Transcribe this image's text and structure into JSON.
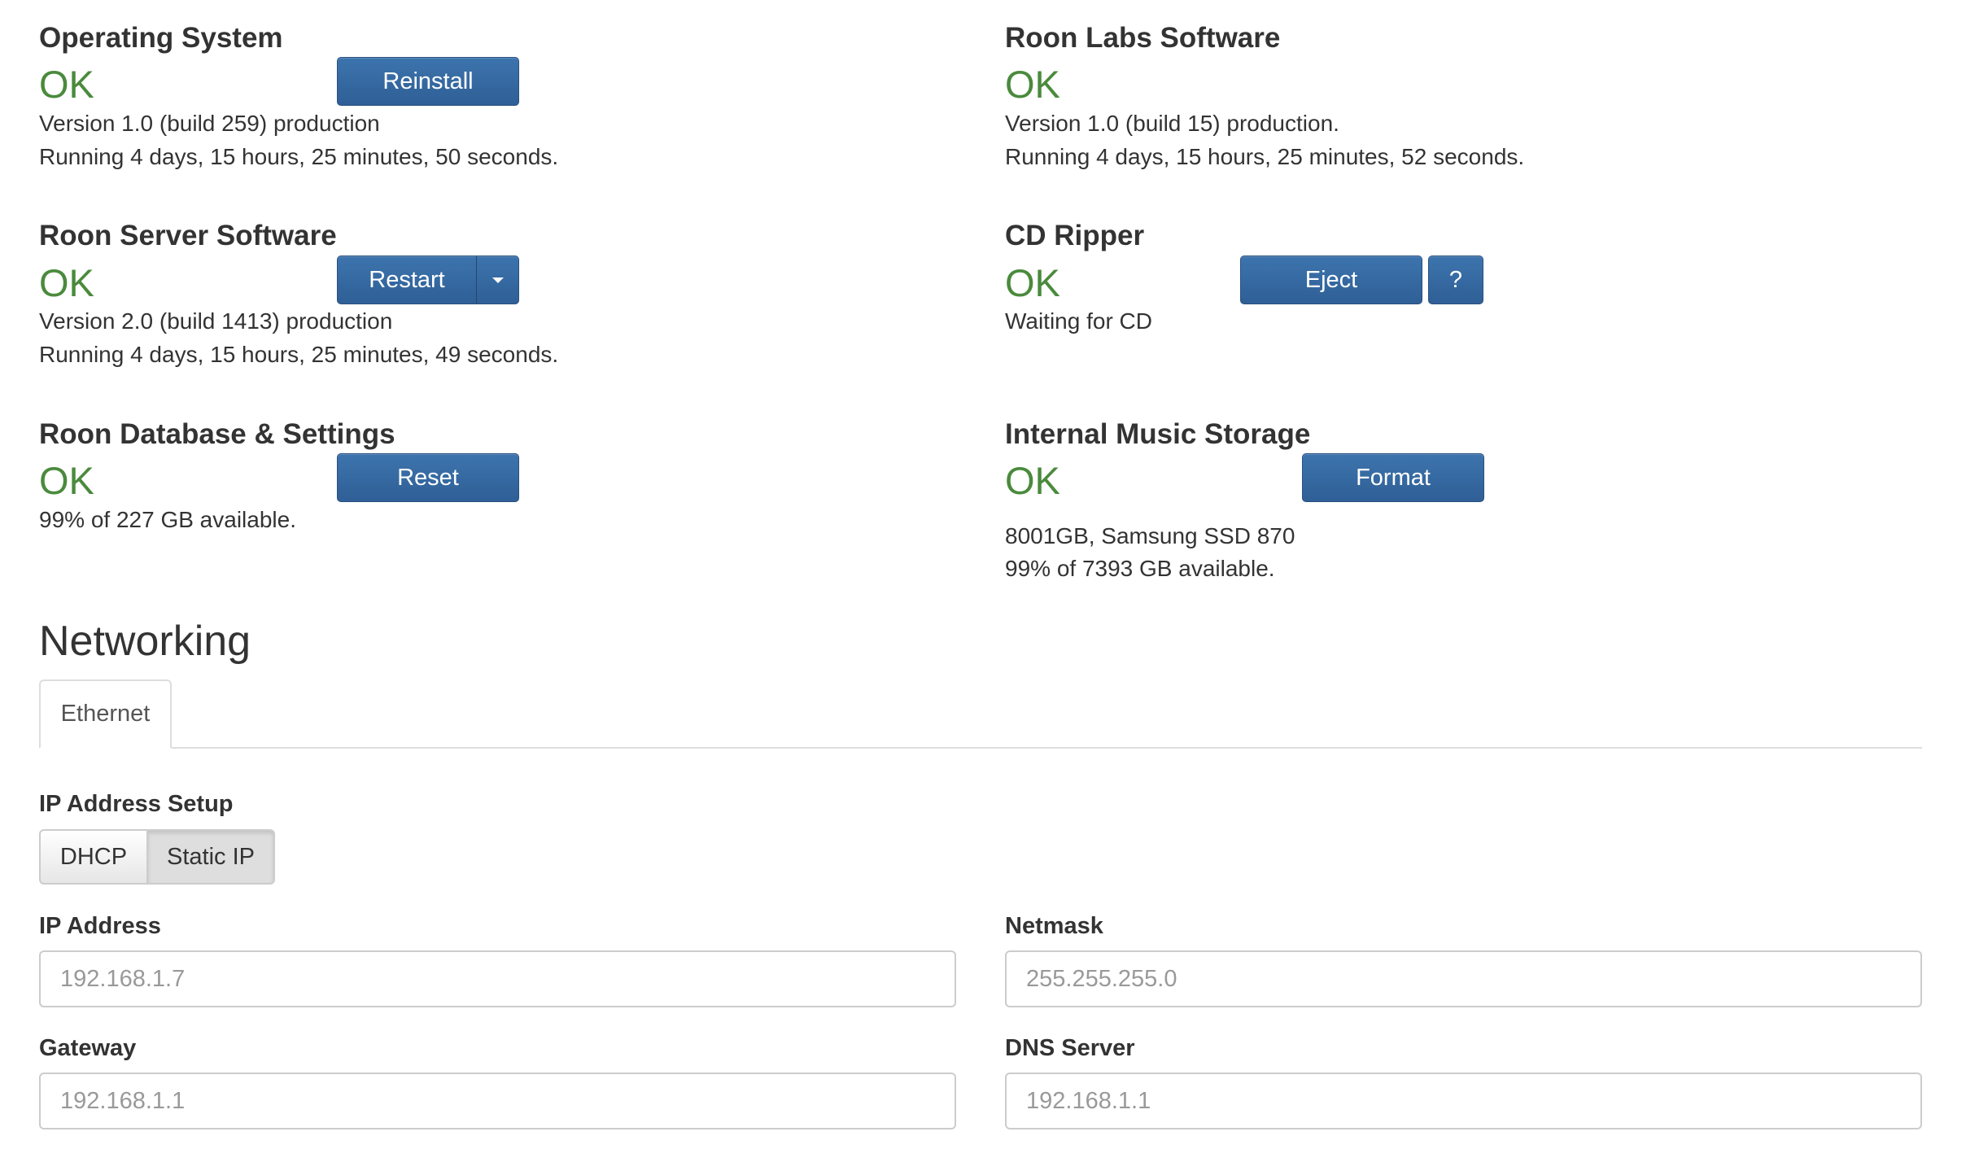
{
  "colors": {
    "ok_green": "#4a8a3c",
    "button_blue": "#336699",
    "text": "#333333"
  },
  "sections": {
    "os": {
      "title": "Operating System",
      "status": "OK",
      "button": "Reinstall",
      "line1": "Version 1.0 (build 259) production",
      "line2": "Running 4 days, 15 hours, 25 minutes, 50 seconds."
    },
    "labs": {
      "title": "Roon Labs Software",
      "status": "OK",
      "line1": "Version 1.0 (build 15) production.",
      "line2": "Running 4 days, 15 hours, 25 minutes, 52 seconds."
    },
    "server": {
      "title": "Roon Server Software",
      "status": "OK",
      "button": "Restart",
      "line1": "Version 2.0 (build 1413) production",
      "line2": "Running 4 days, 15 hours, 25 minutes, 49 seconds."
    },
    "cd": {
      "title": "CD Ripper",
      "status": "OK",
      "button": "Eject",
      "help_button": "?",
      "line1": "Waiting for CD"
    },
    "db": {
      "title": "Roon Database & Settings",
      "status": "OK",
      "button": "Reset",
      "line1": "99% of 227 GB available."
    },
    "storage": {
      "title": "Internal Music Storage",
      "status": "OK",
      "button": "Format",
      "line1": "8001GB, Samsung SSD 870",
      "line2": "99% of 7393 GB available."
    }
  },
  "networking": {
    "heading": "Networking",
    "tab": "Ethernet",
    "ip_setup_label": "IP Address Setup",
    "modes": [
      "DHCP",
      "Static IP"
    ],
    "selected_mode": "Static IP",
    "ip_address": {
      "label": "IP Address",
      "value": "192.168.1.7"
    },
    "netmask": {
      "label": "Netmask",
      "value": "255.255.255.0"
    },
    "gateway": {
      "label": "Gateway",
      "value": "192.168.1.1"
    },
    "dns": {
      "label": "DNS Server",
      "value": "192.168.1.1"
    }
  }
}
